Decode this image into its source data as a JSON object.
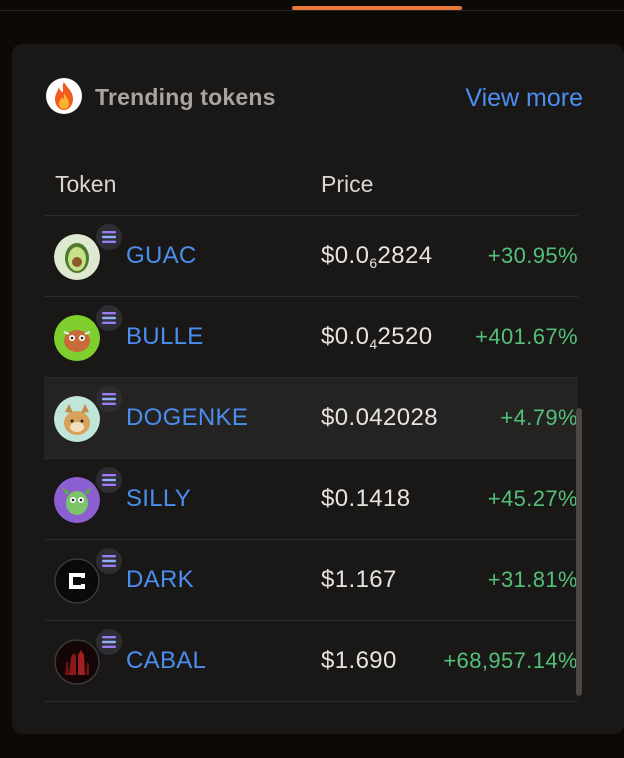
{
  "header": {
    "title": "Trending tokens",
    "view_more": "View more"
  },
  "columns": {
    "token": "Token",
    "price": "Price"
  },
  "tokens": [
    {
      "symbol": "GUAC",
      "price_prefix": "$0.0",
      "price_sub": "6",
      "price_rest": "2824",
      "change": "+30.95%"
    },
    {
      "symbol": "BULLE",
      "price_prefix": "$0.0",
      "price_sub": "4",
      "price_rest": "2520",
      "change": "+401.67%"
    },
    {
      "symbol": "DOGENKE",
      "price_prefix": "$0.042028",
      "price_sub": "",
      "price_rest": "",
      "change": "+4.79%"
    },
    {
      "symbol": "SILLY",
      "price_prefix": "$0.1418",
      "price_sub": "",
      "price_rest": "",
      "change": "+45.27%"
    },
    {
      "symbol": "DARK",
      "price_prefix": "$1.167",
      "price_sub": "",
      "price_rest": "",
      "change": "+31.81%"
    },
    {
      "symbol": "CABAL",
      "price_prefix": "$1.690",
      "price_sub": "",
      "price_rest": "",
      "change": "+68,957.14%"
    }
  ],
  "colors": {
    "accent": "#e8773a",
    "link": "#4b8ef0",
    "positive": "#53c07a",
    "card_bg": "#1a1816"
  },
  "icons": {
    "header": "fire-icon",
    "chain": "solana-icon"
  }
}
